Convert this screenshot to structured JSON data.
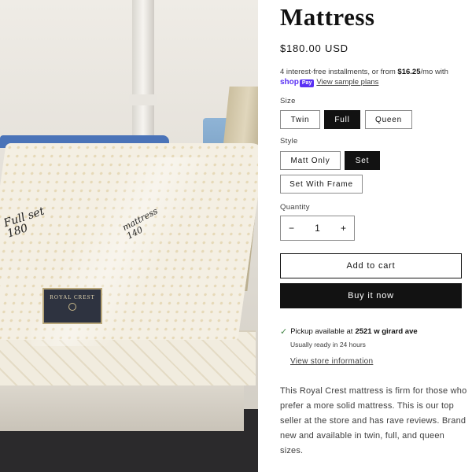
{
  "product": {
    "title": "Mattress",
    "price": "$180.00 USD",
    "installments": {
      "prefix": "4 interest-free installments, or from ",
      "amount": "$16.25",
      "suffix": "/mo with",
      "shop_label": "shop",
      "pay_label": "Pay",
      "link_label": "View sample plans"
    }
  },
  "size": {
    "label": "Size",
    "options": [
      "Twin",
      "Full",
      "Queen"
    ],
    "selected": "Full"
  },
  "style": {
    "label": "Style",
    "options": [
      "Matt Only",
      "Set",
      "Set With Frame"
    ],
    "selected": "Set"
  },
  "quantity": {
    "label": "Quantity",
    "value": "1",
    "minus": "−",
    "plus": "+"
  },
  "actions": {
    "add_to_cart": "Add to cart",
    "buy_now": "Buy it now"
  },
  "pickup": {
    "prefix": "Pickup available at",
    "location": "2521 w girard ave",
    "ready": "Usually ready in 24 hours",
    "store_link": "View store information"
  },
  "description": "This Royal Crest mattress is firm for those who prefer a more solid mattress. This is our top seller at the store and has rave reviews. Brand new and available in twin, full, and queen sizes.",
  "photo": {
    "label_brand": "ROYAL CREST",
    "handwriting_1": "Full set 180",
    "handwriting_2": "mattress 140"
  },
  "colors": {
    "accent": "#121212",
    "shop_pay": "#5a31f4",
    "pickup_check": "#428445"
  }
}
